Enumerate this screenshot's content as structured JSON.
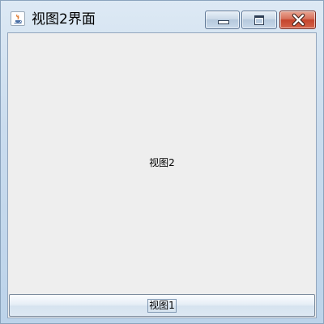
{
  "window": {
    "title": "视图2界面",
    "app_icon": "java-cup-icon"
  },
  "caption_buttons": {
    "minimize_icon": "minimize-icon",
    "maximize_icon": "maximize-icon",
    "close_icon": "close-icon",
    "close_color": "#c4442c"
  },
  "content": {
    "center_label": "视图2",
    "button_label": "视图1",
    "background": "#eeeeee"
  }
}
